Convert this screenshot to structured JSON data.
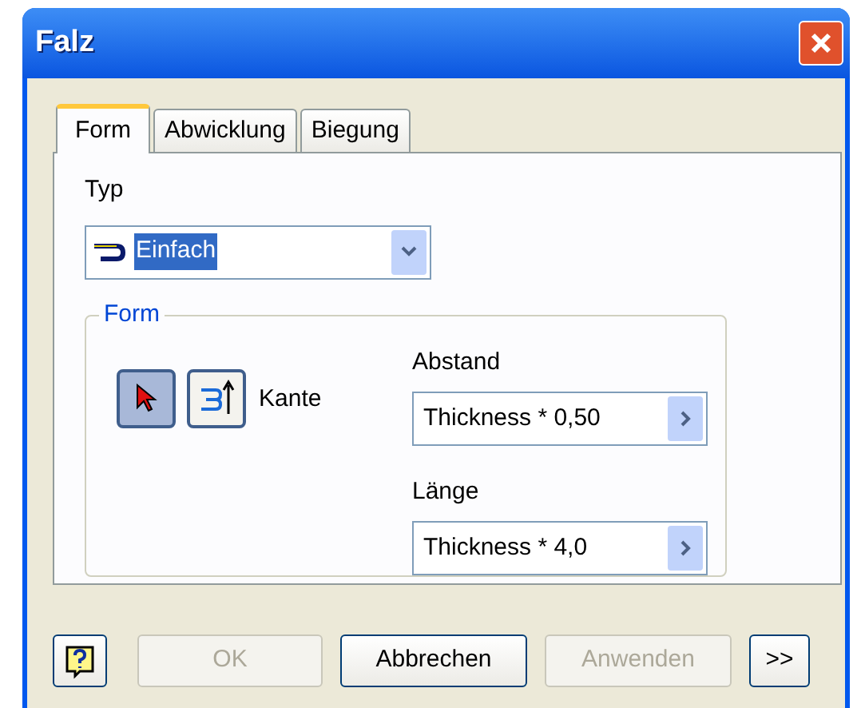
{
  "window": {
    "title": "Falz"
  },
  "tabs": [
    {
      "label": "Form",
      "selected": true
    },
    {
      "label": "Abwicklung",
      "selected": false
    },
    {
      "label": "Biegung",
      "selected": false
    }
  ],
  "typ": {
    "label": "Typ",
    "value": "Einfach"
  },
  "group": {
    "title": "Form",
    "pickers": [
      {
        "kind": "arrow",
        "selected": true
      },
      {
        "kind": "edge",
        "selected": false
      }
    ],
    "picker_label": "Kante",
    "fields": [
      {
        "label": "Abstand",
        "value": "Thickness * 0,50"
      },
      {
        "label": "Länge",
        "value": "Thickness * 4,0"
      }
    ]
  },
  "buttons": [
    {
      "kind": "help",
      "disabled": false
    },
    {
      "kind": "text",
      "label": "OK",
      "disabled": true
    },
    {
      "kind": "text",
      "label": "Abbrechen",
      "disabled": false
    },
    {
      "kind": "text",
      "label": "Anwenden",
      "disabled": true
    },
    {
      "kind": "text",
      "label": ">>",
      "disabled": false
    }
  ]
}
